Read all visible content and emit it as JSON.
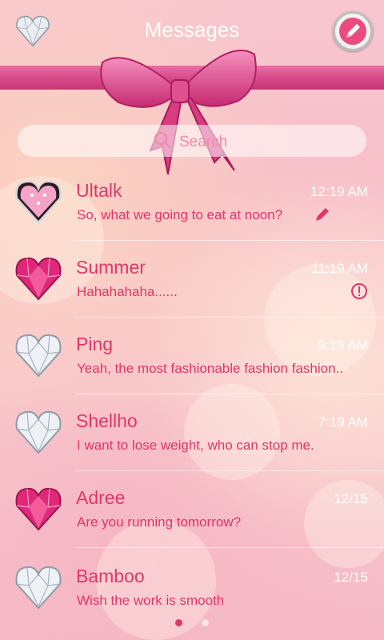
{
  "header": {
    "title": "Messages"
  },
  "search": {
    "placeholder": "Search"
  },
  "conversations": [
    {
      "name": "Ultalk",
      "time": "12:19 AM",
      "preview": "So, what we going to eat at noon?",
      "avatar": "pink-diamond-heart-icon",
      "status": "draft-pencil-icon"
    },
    {
      "name": "Summer",
      "time": "11:19 AM",
      "preview": "Hahahahaha......",
      "avatar": "ruby-heart-icon",
      "status": "error-alert-icon"
    },
    {
      "name": "Ping",
      "time": "9:19 AM",
      "preview": "Yeah, the most fashionable fashion fashion..",
      "avatar": "diamond-heart-icon",
      "status": ""
    },
    {
      "name": "Shellho",
      "time": "7:19 AM",
      "preview": "I want to lose weight, who can stop me.",
      "avatar": "diamond-heart-icon",
      "status": ""
    },
    {
      "name": "Adree",
      "time": "12/15",
      "preview": "Are you running tomorrow?",
      "avatar": "ruby-heart-icon",
      "status": ""
    },
    {
      "name": "Bamboo",
      "time": "12/15",
      "preview": "Wish the work is smooth",
      "avatar": "diamond-heart-icon",
      "status": ""
    }
  ],
  "pager": {
    "pages": 2,
    "current": 1
  },
  "colors": {
    "accent": "#e0356b",
    "ribbon": "#d63f84",
    "time_text": "#ffffff",
    "search_text": "#f28aa6"
  }
}
